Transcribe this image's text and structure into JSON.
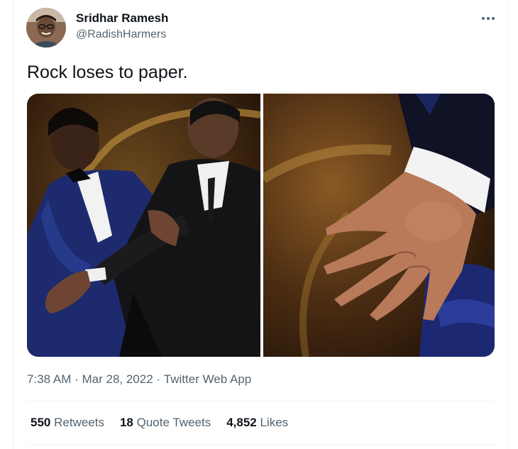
{
  "author": {
    "display_name": "Sridhar Ramesh",
    "handle": "@RadishHarmers",
    "avatar_icon": "user-avatar"
  },
  "tweet": {
    "text": "Rock loses to paper."
  },
  "meta": {
    "time": "7:38 AM",
    "sep1": " · ",
    "date": "Mar 28, 2022",
    "sep2": " · ",
    "source": "Twitter Web App"
  },
  "stats": [
    {
      "count": "550",
      "label": " Retweets"
    },
    {
      "count": "18",
      "label": " Quote Tweets"
    },
    {
      "count": "4,852",
      "label": " Likes"
    }
  ],
  "colors": {
    "text_primary": "#0f1419",
    "text_secondary": "#536471",
    "divider": "#eff3f4"
  }
}
